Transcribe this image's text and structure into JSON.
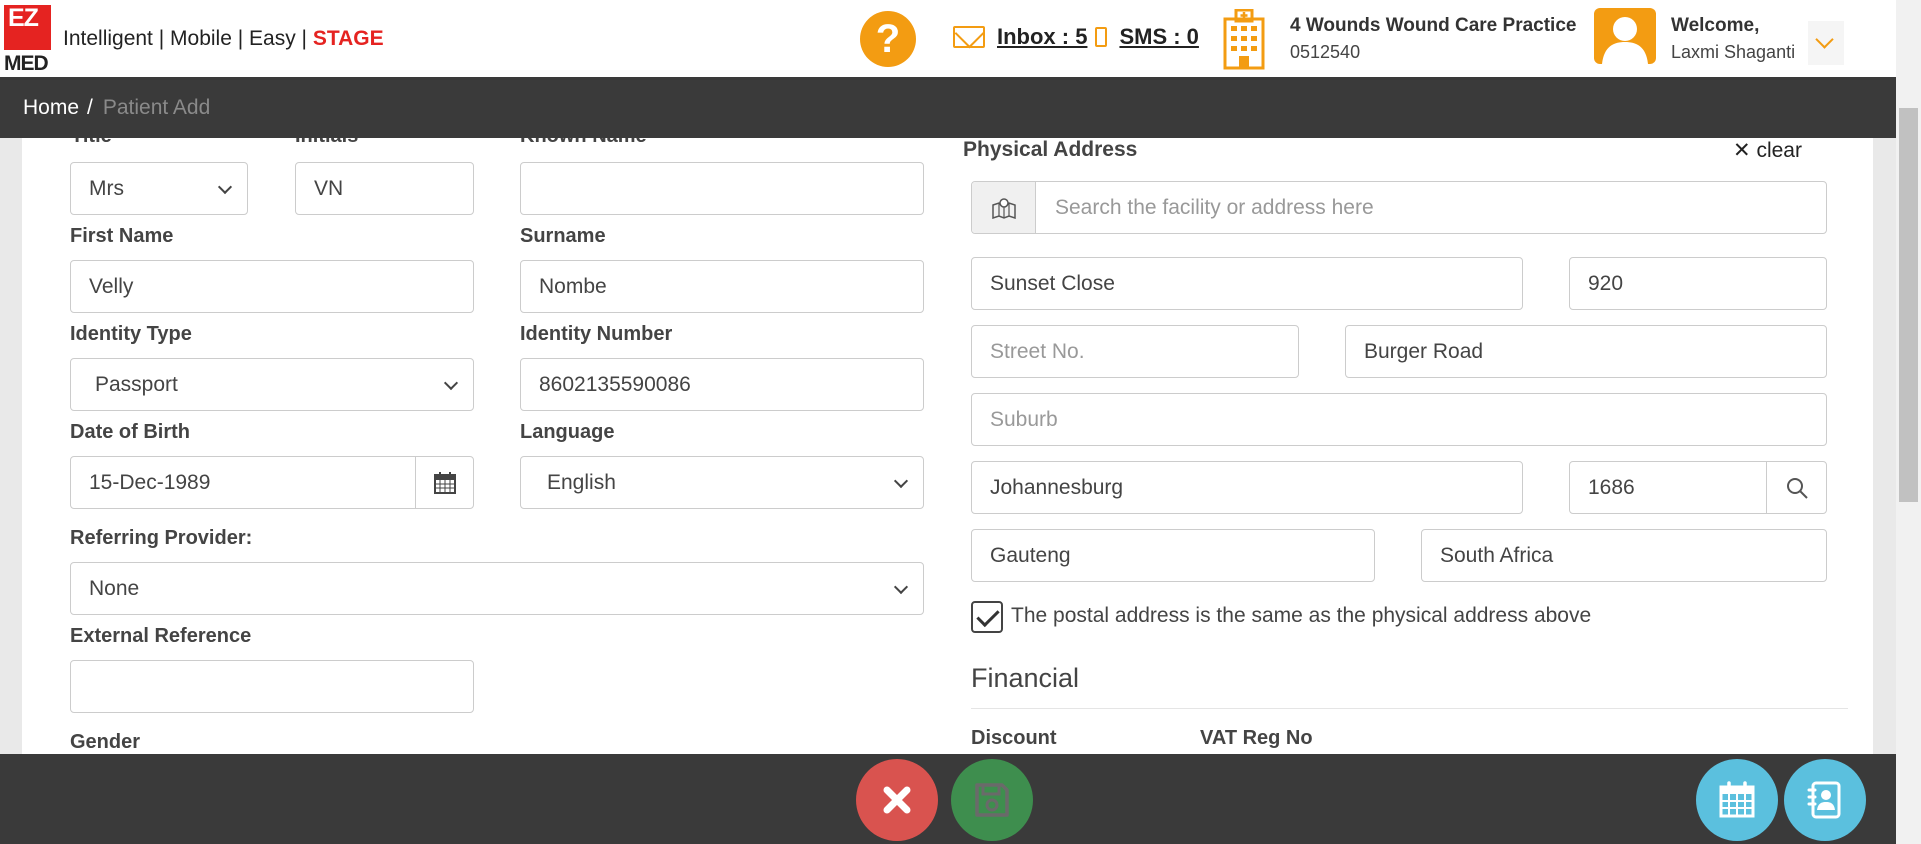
{
  "header": {
    "logo_top": "EZ",
    "logo_bottom": "MED",
    "tagline": "Intelligent | Mobile | Easy | ",
    "env": "STAGE",
    "help_symbol": "?",
    "inbox": "Inbox : 5",
    "sms": "SMS : 0",
    "practice_name": "4 Wounds Wound Care Practice",
    "practice_code": "0512540",
    "welcome": "Welcome,",
    "user_name": "Laxmi Shaganti"
  },
  "breadcrumb": {
    "home": "Home",
    "separator": "/",
    "current": "Patient Add"
  },
  "form": {
    "title_label": "Title",
    "title_value": "Mrs",
    "initials_label": "Initials",
    "initials_value": "VN",
    "known_name_label": "Known Name",
    "known_name_value": "",
    "first_name_label": "First Name",
    "first_name_value": "Velly",
    "surname_label": "Surname",
    "surname_value": "Nombe",
    "identity_type_label": "Identity Type",
    "identity_type_value": "Passport",
    "identity_number_label": "Identity Number",
    "identity_number_value": "8602135590086",
    "dob_label": "Date of Birth",
    "dob_value": "15-Dec-1989",
    "language_label": "Language",
    "language_value": "English",
    "referring_label": "Referring Provider:",
    "referring_value": "None",
    "external_ref_label": "External Reference",
    "external_ref_value": "",
    "gender_label": "Gender"
  },
  "address": {
    "title": "Physical Address",
    "clear_label": "clear",
    "search_placeholder": "Search the facility or address here",
    "complex": "Sunset Close",
    "unit": "920",
    "street_no_placeholder": "Street No.",
    "street": "Burger Road",
    "suburb_placeholder": "Suburb",
    "city": "Johannesburg",
    "postal_code": "1686",
    "province": "Gauteng",
    "country": "South Africa",
    "postal_same_checked": true,
    "postal_same_label": "The postal address is the same as the physical address above"
  },
  "financial": {
    "title": "Financial",
    "discount_label": "Discount",
    "vat_label": "VAT Reg No"
  },
  "colors": {
    "brand_red": "#e52321",
    "accent_orange": "#f39c12",
    "dark_bar": "#3a3a3a",
    "cancel": "#d9534f",
    "save": "#3e8e4e",
    "info": "#5bc0de"
  }
}
